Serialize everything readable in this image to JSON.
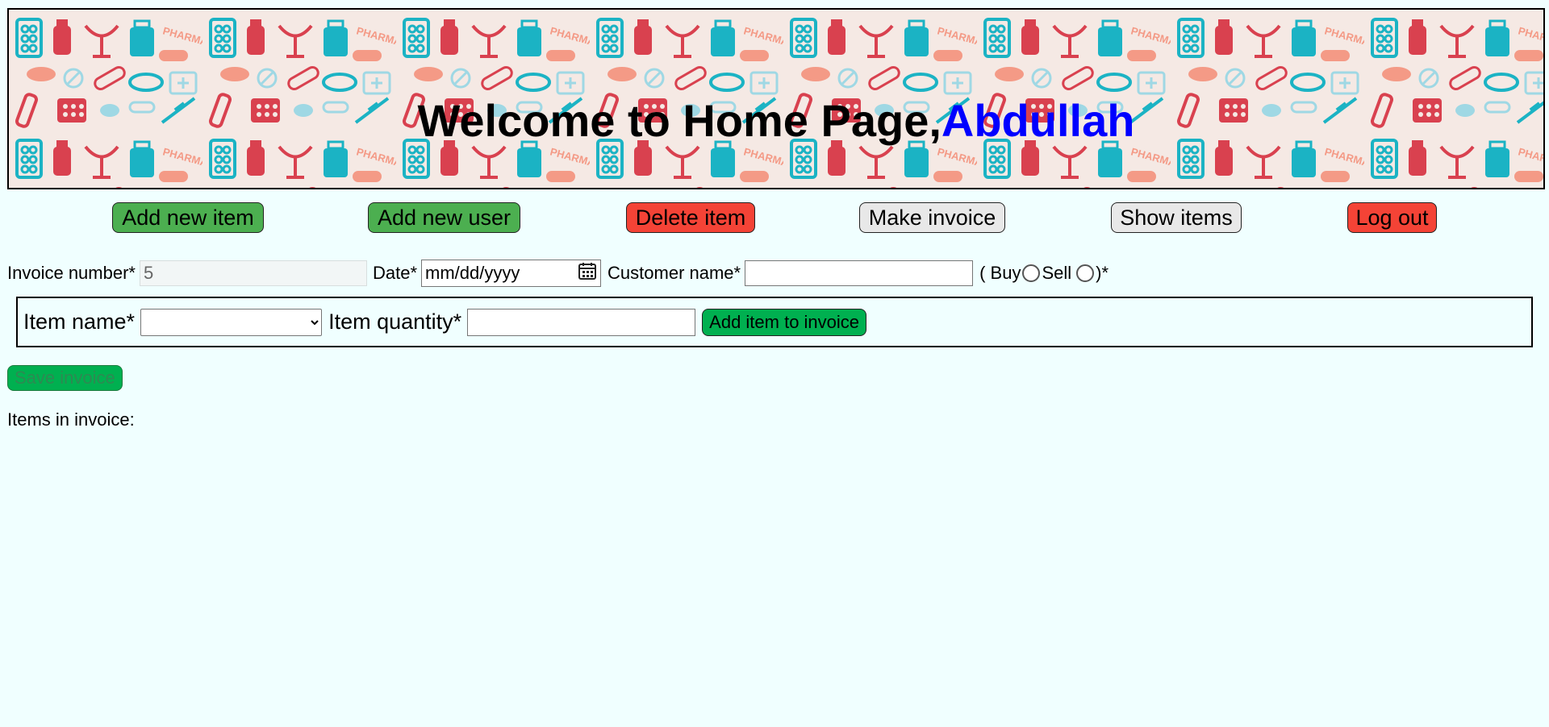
{
  "header": {
    "welcome_text": "Welcome to Home Page,",
    "username": "Abdullah",
    "pattern_label": "PHARMACY"
  },
  "nav": {
    "add_item": "Add new item",
    "add_user": "Add new user",
    "delete_item": "Delete item",
    "make_invoice": "Make invoice",
    "show_items": "Show items",
    "logout": "Log out"
  },
  "invoice": {
    "number_label": "Invoice number*",
    "number_value": "5",
    "date_label": "Date*",
    "date_placeholder": "mm/dd/yyyy",
    "customer_label": "Customer name*",
    "customer_value": "",
    "type_open": "( Buy",
    "sell_label": "Sell",
    "type_close": ")*"
  },
  "item_form": {
    "name_label": "Item name*",
    "selected_item": "",
    "quantity_label": "Item quantity*",
    "quantity_value": "",
    "add_button": "Add item to invoice"
  },
  "save_button": "Save invoice",
  "items_label": "Items in invoice:",
  "colors": {
    "background": "#f0ffff",
    "green_button": "#4caf50",
    "red_button": "#f44336",
    "gray_button": "#e8e8e8",
    "save_green": "#00b050",
    "username": "#0000ff",
    "pattern_red": "#d9414f",
    "pattern_teal": "#1bb3c4",
    "pattern_salmon": "#f49a86",
    "pattern_lightblue": "#9fd8e4"
  }
}
